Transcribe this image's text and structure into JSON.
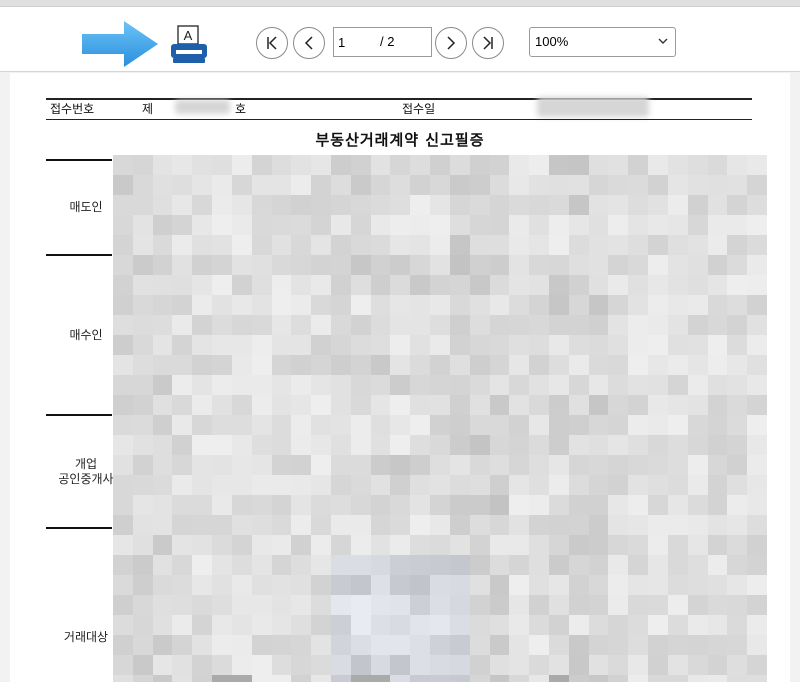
{
  "toolbar": {
    "arrow_icon": "right-arrow-icon",
    "print_icon": "printer-icon",
    "print_glyph": "A",
    "nav": {
      "first_icon": "first-page-icon",
      "prev_icon": "prev-page-icon",
      "next_icon": "next-page-icon",
      "last_icon": "last-page-icon"
    },
    "page_current": "1",
    "page_total": "/ 2",
    "zoom": "100%"
  },
  "colors": {
    "arrow": "#3aa0e8",
    "printer": "#1d5fa8"
  },
  "document": {
    "receipt_no_label": "접수번호",
    "receipt_prefix": "제",
    "receipt_suffix": "호",
    "receipt_date_label": "접수일",
    "title": "부동산거래계약 신고필증",
    "sections": [
      "매도인",
      "매수인",
      "개업\n공인중개사",
      "거래대상"
    ]
  }
}
